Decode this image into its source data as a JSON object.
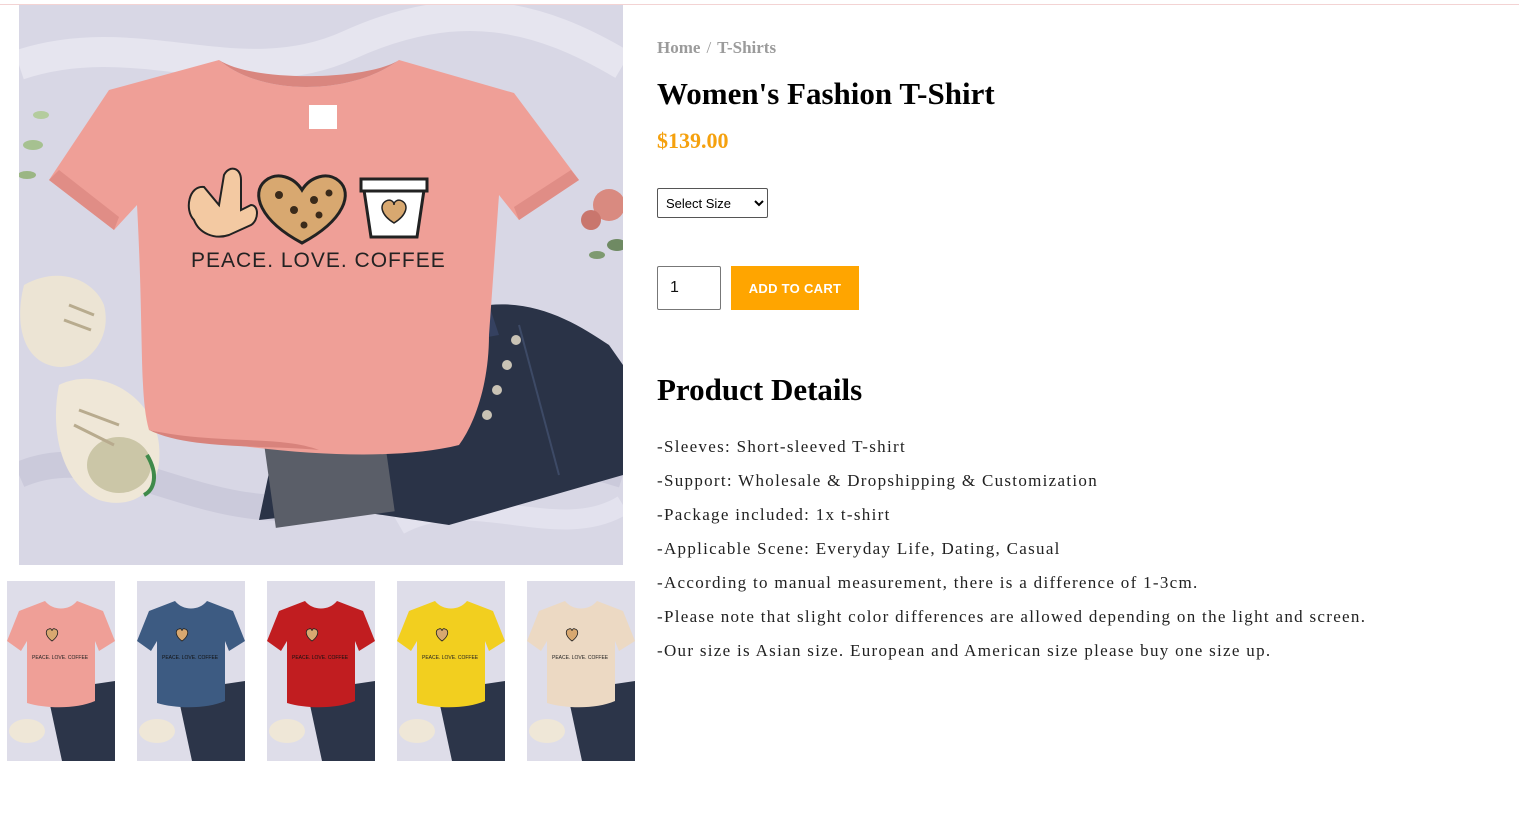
{
  "breadcrumb": {
    "home": "Home",
    "separator": "/",
    "category": "T-Shirts"
  },
  "product": {
    "title": "Women's Fashion T-Shirt",
    "price": "$139.00",
    "shirt_print": "PEACE. LOVE. COFFEE",
    "size_select": {
      "selected": "Select Size"
    },
    "quantity": "1",
    "add_to_cart_label": "ADD TO CART"
  },
  "details": {
    "heading": "Product Details",
    "items": [
      "-Sleeves: Short-sleeved T-shirt",
      "-Support: Wholesale & Dropshipping & Customization",
      "-Package included: 1x t-shirt",
      "-Applicable Scene: Everyday Life, Dating, Casual",
      "-According to manual measurement, there is a difference of 1-3cm.",
      "-Please note that slight color differences are allowed depending on the light and screen.",
      "-Our size is Asian size. European and American size please buy one size up."
    ]
  },
  "thumbnails": [
    {
      "color": "#ef9f97",
      "name": "pink"
    },
    {
      "color": "#3d5b82",
      "name": "navy"
    },
    {
      "color": "#c11d20",
      "name": "red"
    },
    {
      "color": "#f2cf1f",
      "name": "yellow"
    },
    {
      "color": "#ecd9c3",
      "name": "cream"
    }
  ],
  "colors": {
    "accent": "#ffa500",
    "price": "#f5a10e",
    "breadcrumb": "#9b9b9b"
  }
}
